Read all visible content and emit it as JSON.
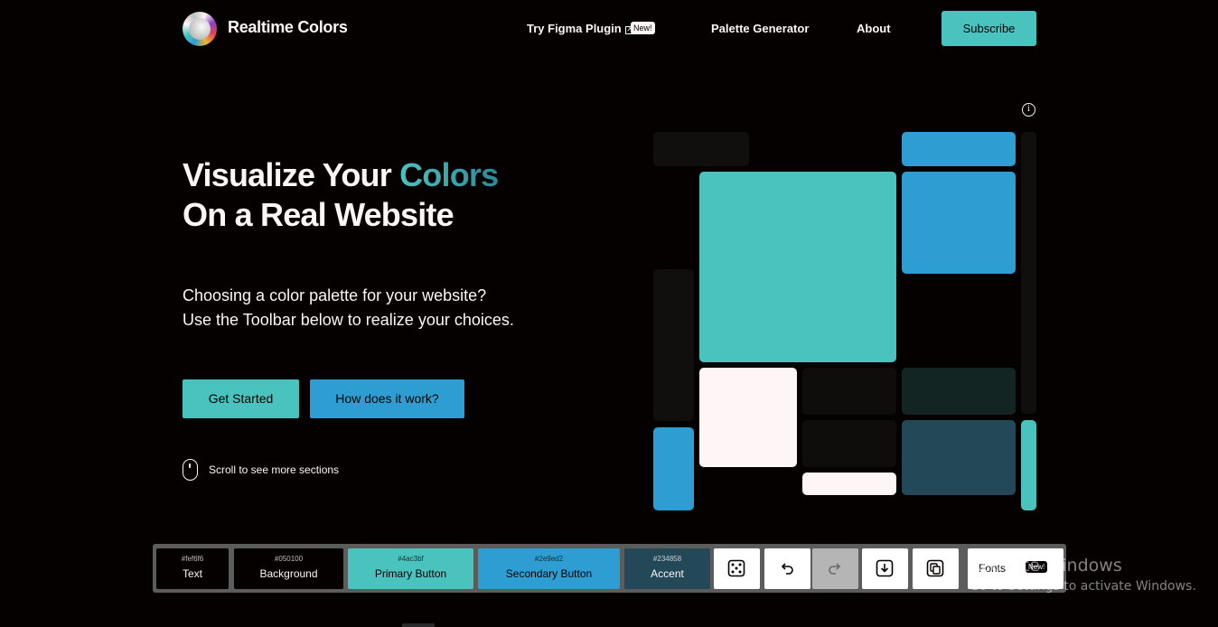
{
  "nav": {
    "brand": "Realtime Colors",
    "figma_label": "Try Figma Plugin",
    "figma_badge": "New!",
    "palette_label": "Palette Generator",
    "about_label": "About",
    "subscribe_label": "Subscribe"
  },
  "hero": {
    "title_part1": "Visualize Your ",
    "title_accent": "Colors",
    "title_line2": "On a Real Website",
    "sub_line1": "Choosing a color palette for your website?",
    "sub_line2": "Use the Toolbar below to realize your choices.",
    "primary_cta": "Get Started",
    "secondary_cta": "How does it work?",
    "scroll_hint": "Scroll to see more sections"
  },
  "colors": {
    "text": "#fef6f6",
    "background": "#050100",
    "primary": "#4ac3bf",
    "secondary": "#2e9ed2",
    "accent": "#234858"
  },
  "toolbar": {
    "swatches": [
      {
        "hex": "#fef6f6",
        "label": "Text"
      },
      {
        "hex": "#050100",
        "label": "Background"
      },
      {
        "hex": "#4ac3bf",
        "label": "Primary Button"
      },
      {
        "hex": "#2e9ed2",
        "label": "Secondary Button"
      },
      {
        "hex": "#234858",
        "label": "Accent"
      }
    ],
    "tools": [
      "dice-icon",
      "undo-icon",
      "redo-icon",
      "export-icon",
      "copy-icon"
    ],
    "fonts_label": "Fonts",
    "fonts_badge": "New!"
  },
  "os_watermark": {
    "line1": "Activate Windows",
    "line2": "Go to Settings to activate Windows."
  }
}
